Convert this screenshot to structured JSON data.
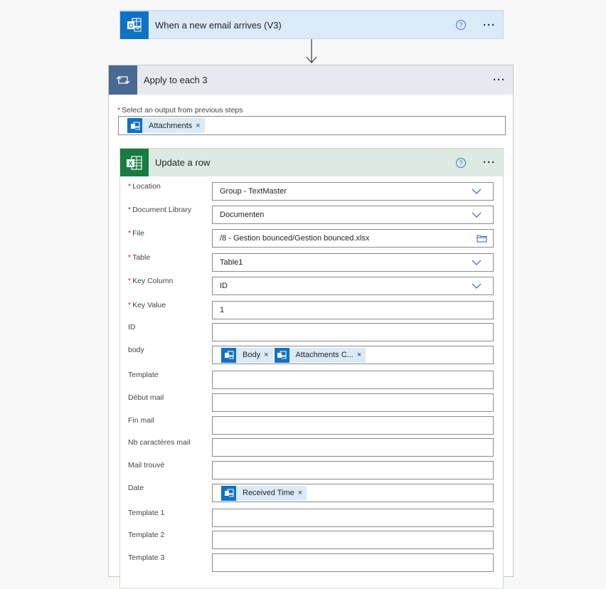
{
  "trigger": {
    "title": "When a new email arrives (V3)",
    "icon": "outlook-icon",
    "help_glyph": "?",
    "more_glyph": "···"
  },
  "apply_each": {
    "title": "Apply to each 3",
    "icon": "loop-icon",
    "more_glyph": "···",
    "select_label": "Select an output from previous steps",
    "required_mark": "*",
    "token": {
      "label": "Attachments",
      "remove": "×"
    }
  },
  "update_row": {
    "title": "Update a row",
    "icon": "excel-icon",
    "help_glyph": "?",
    "more_glyph": "···",
    "fields": [
      {
        "label": "Location",
        "required": "*",
        "value": "Group - TextMaster",
        "control": "dropdown"
      },
      {
        "label": "Document Library",
        "required": "*",
        "value": "Documenten",
        "control": "dropdown"
      },
      {
        "label": "File",
        "required": "*",
        "value": "/8 - Gestion bounced/Gestion bounced.xlsx",
        "control": "file-picker"
      },
      {
        "label": "Table",
        "required": "*",
        "value": "Table1",
        "control": "dropdown"
      },
      {
        "label": "Key Column",
        "required": "*",
        "value": "ID",
        "control": "dropdown"
      },
      {
        "label": "Key Value",
        "required": "*",
        "value": "1",
        "control": "text"
      },
      {
        "label": "ID",
        "value": "",
        "control": "text"
      },
      {
        "label": "body",
        "control": "tokens",
        "tokens": [
          {
            "label": "Body",
            "remove": "×"
          },
          {
            "label": "Attachments C...",
            "remove": "×"
          }
        ]
      },
      {
        "label": "Template",
        "value": "",
        "control": "text"
      },
      {
        "label": "Début mail",
        "value": "",
        "control": "text"
      },
      {
        "label": "Fin mail",
        "value": "",
        "control": "text"
      },
      {
        "label": "Nb caractères mail",
        "value": "",
        "control": "text"
      },
      {
        "label": "Mail trouvé",
        "value": "",
        "control": "text"
      },
      {
        "label": "Date",
        "control": "tokens",
        "tokens": [
          {
            "label": "Received Time",
            "remove": "×"
          }
        ]
      },
      {
        "label": "Template 1",
        "value": "",
        "control": "text"
      },
      {
        "label": "Template 2",
        "value": "",
        "control": "text"
      },
      {
        "label": "Template 3",
        "value": "",
        "control": "text"
      }
    ]
  },
  "colors": {
    "outlook_blue": "#0f72c5",
    "trigger_bg": "#dbeaf7",
    "loop_blue": "#486991",
    "loop_header_bg": "#e6e9ef",
    "excel_green": "#187c41",
    "excel_header_bg": "#dceae1",
    "required_red": "#c4262e"
  }
}
